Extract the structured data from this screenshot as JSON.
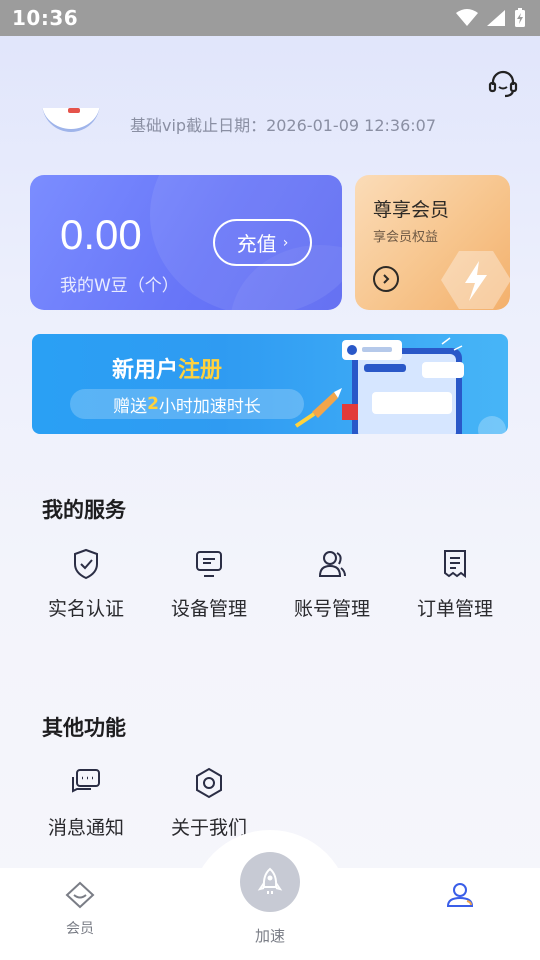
{
  "status_bar": {
    "time": "10:36"
  },
  "profile": {
    "vip_expiry_text": "基础vip截止日期：2026-01-09 12:36:07"
  },
  "wallet": {
    "balance": "0.00",
    "label": "我的W豆（个）",
    "recharge_label": "充值"
  },
  "member_card": {
    "title": "尊享会员",
    "subtitle": "享会员权益"
  },
  "banner": {
    "title_prefix": "新用户",
    "title_highlight": "注册",
    "pill_prefix": "赠送",
    "pill_highlight": "2",
    "pill_suffix": "小时加速时长"
  },
  "my_services": {
    "title": "我的服务",
    "items": [
      {
        "label": "实名认证",
        "icon": "shield-check-icon"
      },
      {
        "label": "设备管理",
        "icon": "monitor-icon"
      },
      {
        "label": "账号管理",
        "icon": "users-icon"
      },
      {
        "label": "订单管理",
        "icon": "document-icon"
      }
    ]
  },
  "other_features": {
    "title": "其他功能",
    "items": [
      {
        "label": "消息通知",
        "icon": "message-icon"
      },
      {
        "label": "关于我们",
        "icon": "hexagon-icon"
      }
    ]
  },
  "tab_bar": {
    "items": [
      {
        "label": "会员",
        "icon": "diamond-icon"
      },
      {
        "label": "加速",
        "icon": "rocket-icon"
      },
      {
        "label": "",
        "icon": "user-icon",
        "active": true
      }
    ]
  },
  "colors": {
    "accent": "#5c69f2",
    "member_gold": "#f7c58d",
    "banner_blue": "#2f9bf2",
    "highlight_yellow": "#ffd23d"
  }
}
